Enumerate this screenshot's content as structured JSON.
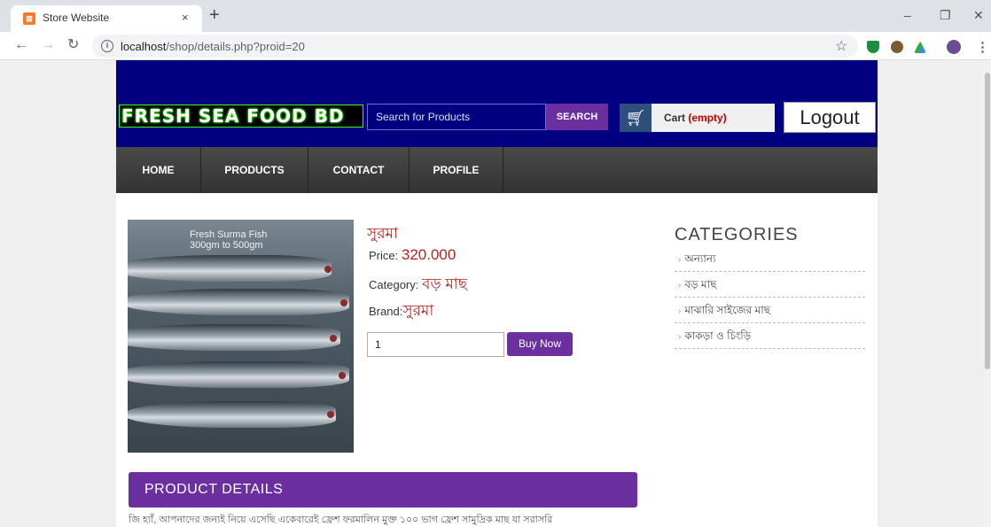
{
  "browser": {
    "tab_title": "Store Website",
    "tab_close": "×",
    "new_tab": "+",
    "url_host": "localhost",
    "url_path": "/shop/details.php?proid=20",
    "win_minimize": "–",
    "win_restore": "❐",
    "win_close": "✕"
  },
  "header": {
    "logo": "FRESH SEA FOOD BD",
    "search_placeholder": "Search for Products",
    "search_button": "SEARCH",
    "cart_label": "Cart",
    "cart_status": "(empty)",
    "logout": "Logout"
  },
  "menu": [
    "HOME",
    "PRODUCTS",
    "CONTACT",
    "PROFILE"
  ],
  "product": {
    "image_caption_line1": "Fresh Surma Fish",
    "image_caption_line2": "300gm to 500gm",
    "name": "সুরমা",
    "price_label": "Price:",
    "price": "320.000",
    "category_label": "Category:",
    "category": "বড় মাছ",
    "brand_label": "Brand:",
    "brand": "সুরমা",
    "quantity": "1",
    "buy_button": "Buy Now"
  },
  "categories": {
    "title": "CATEGORIES",
    "items": [
      "অন্যান্য",
      "বড় মাছ",
      "মাঝারি সাইজের মাছ",
      "কাকড়া ও চিংড়ি"
    ]
  },
  "details": {
    "heading": "PRODUCT DETAILS",
    "text": "জি হ্যাঁ, আপনাদের জন্যই নিয়ে এসেছি একেবারেই ফ্রেশ ফরমালিন মুক্ত ১০০ ভাগ ফ্রেশ সামুদ্রিক মাছ যা সরাসরি"
  },
  "colors": {
    "header_bg": "#000080",
    "accent": "#6b2fa0",
    "menubar": "#3f3f3f",
    "price_red": "#b22222"
  }
}
